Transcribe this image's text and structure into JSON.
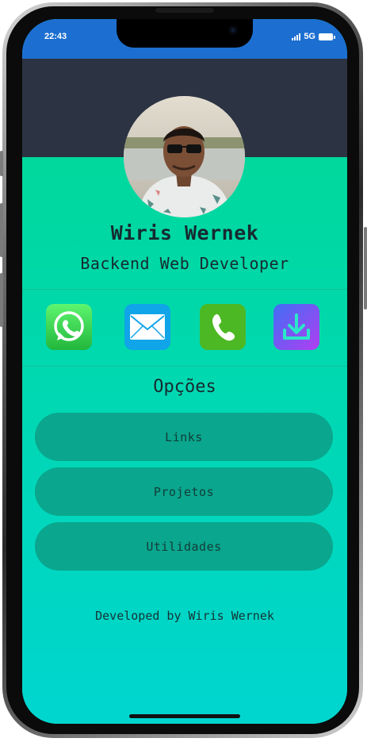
{
  "status_bar": {
    "time": "22:43",
    "network": "5G"
  },
  "profile": {
    "name": "Wiris Wernek",
    "role": "Backend Web Developer"
  },
  "contacts": [
    {
      "icon": "whatsapp-icon",
      "color": "#2fd047"
    },
    {
      "icon": "mail-icon",
      "color": "#10a4e8"
    },
    {
      "icon": "phone-icon",
      "color": "#4cb824"
    },
    {
      "icon": "download-icon",
      "color": "#7a3df0"
    }
  ],
  "options": {
    "title": "Opções",
    "items": [
      "Links",
      "Projetos",
      "Utilidades"
    ]
  },
  "footer": {
    "text": "Developed by Wiris Wernek"
  },
  "colors": {
    "status_bar": "#1c6fd0",
    "header_dark": "#2c3342",
    "gradient_top": "#00d994",
    "gradient_bottom": "#00d6cf",
    "option_button": "#0aa68d"
  }
}
